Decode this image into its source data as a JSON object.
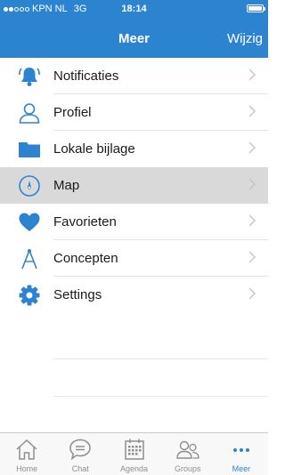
{
  "status_bar": {
    "carrier": "KPN NL",
    "network": "3G",
    "time": "18:14",
    "signal_bars_filled": 2,
    "signal_bars_total": 5
  },
  "navbar": {
    "title": "Meer",
    "edit_label": "Wijzig"
  },
  "menu": {
    "items": [
      {
        "label": "Notificaties",
        "icon": "bell-icon"
      },
      {
        "label": "Profiel",
        "icon": "person-icon"
      },
      {
        "label": "Lokale bijlage",
        "icon": "folder-icon"
      },
      {
        "label": "Map",
        "icon": "compass-icon",
        "selected": true
      },
      {
        "label": "Favorieten",
        "icon": "heart-icon"
      },
      {
        "label": "Concepten",
        "icon": "drafting-compass-icon"
      },
      {
        "label": "Settings",
        "icon": "gear-icon"
      }
    ]
  },
  "tabbar": {
    "tabs": [
      {
        "label": "Home",
        "icon": "house-icon"
      },
      {
        "label": "Chat",
        "icon": "chat-bubble-icon"
      },
      {
        "label": "Agenda",
        "icon": "calendar-icon"
      },
      {
        "label": "Groups",
        "icon": "people-icon"
      },
      {
        "label": "Meer",
        "icon": "more-dots-icon",
        "active": true
      }
    ]
  },
  "colors": {
    "accent": "#2c83d0",
    "selected_row": "#d9d9d9",
    "tab_inactive": "#8e8e8e"
  }
}
